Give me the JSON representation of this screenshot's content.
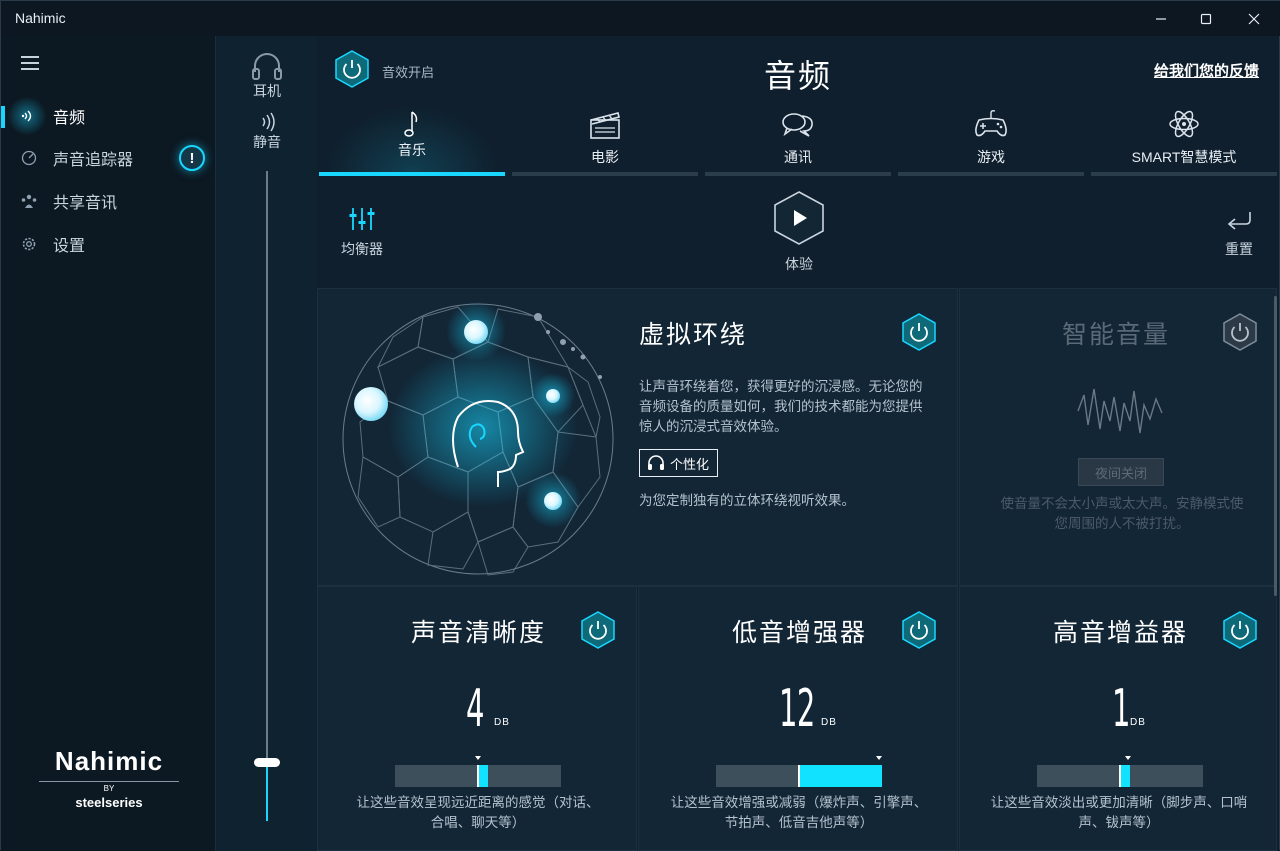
{
  "window": {
    "title": "Nahimic"
  },
  "nav": {
    "items": [
      {
        "label": "音频",
        "icon": "audio-wave-icon"
      },
      {
        "label": "声音追踪器",
        "icon": "sound-tracker-icon",
        "badge": "!"
      },
      {
        "label": "共享音讯",
        "icon": "share-audio-icon"
      },
      {
        "label": "设置",
        "icon": "gear-icon"
      }
    ],
    "brand": {
      "name": "Nahimic",
      "by": "BY",
      "partner": "steelseries"
    }
  },
  "volume": {
    "device_label": "耳机",
    "mute_label": "静音",
    "level": 0.09
  },
  "header": {
    "effects_on_label": "音效开启",
    "title": "音频",
    "feedback": "给我们您的反馈"
  },
  "tabs": [
    {
      "label": "音乐",
      "icon": "music-note-icon",
      "active": true
    },
    {
      "label": "电影",
      "icon": "clapperboard-icon",
      "active": false
    },
    {
      "label": "通讯",
      "icon": "chat-bubbles-icon",
      "active": false
    },
    {
      "label": "游戏",
      "icon": "gamepad-icon",
      "active": false
    },
    {
      "label": "SMART智慧模式",
      "icon": "atom-icon",
      "active": false
    }
  ],
  "toolbar": {
    "equalizer": "均衡器",
    "experience": "体验",
    "reset": "重置"
  },
  "panels": {
    "surround": {
      "title": "虚拟环绕",
      "desc": "让声音环绕着您，获得更好的沉浸感。无论您的音频设备的质量如何，我们的技术都能为您提供惊人的沉浸式音效体验。",
      "personalize": "个性化",
      "note": "为您定制独有的立体环绕视听效果。"
    },
    "smart_volume": {
      "title": "智能音量",
      "night_mode": "夜间关闭",
      "desc": "使音量不会太小声或太大声。安静模式使您周围的人不被打扰。"
    },
    "clarity": {
      "title": "声音清晰度",
      "value": "4",
      "unit": "DB",
      "level": 0.5,
      "desc": "让这些音效呈现远近距离的感觉（对话、合唱、聊天等）"
    },
    "bass": {
      "title": "低音增强器",
      "value": "12",
      "unit": "DB",
      "level": 1.0,
      "desc": "让这些音效增强或减弱（爆炸声、引擎声、节拍声、低音吉他声等）"
    },
    "treble": {
      "title": "高音增益器",
      "value": "1",
      "unit": "DB",
      "level": 0.55,
      "desc": "让这些音效淡出或更加清晰（脚步声、口哨声、钹声等）"
    }
  },
  "colors": {
    "accent": "#19d6ff",
    "background": "#0f1f2d",
    "panel": "#122636"
  }
}
